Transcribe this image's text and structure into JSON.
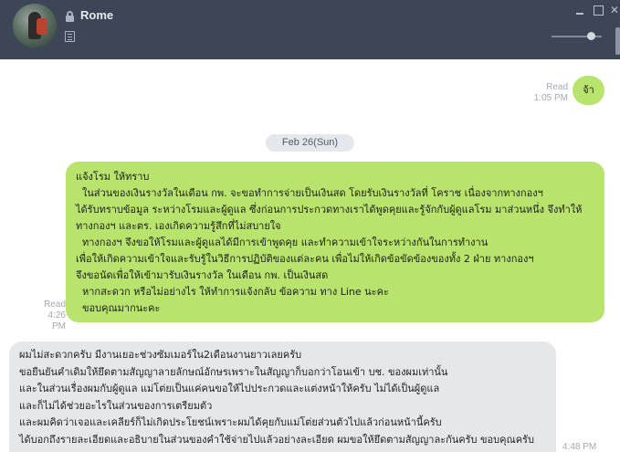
{
  "header": {
    "chat_name": "Rome"
  },
  "messages": {
    "m1": {
      "text": "จ้า",
      "status": "Read",
      "time": "1:05 PM"
    },
    "date_separator": "Feb 26(Sun)",
    "m2": {
      "status": "Read",
      "time": "4:26 PM",
      "lines": [
        "แจ้งโรม ให้ทราบ",
        "  ในส่วนของเงินรางวัลในเดือน กพ. จะขอทำการจ่ายเป็นเงินสด โดยรับเงินรางวัลที่ โคราช เนื่องจากทางกองฯ",
        "ได้รับทราบข้อมูล ระหว่างโรมและผู้ดูแล ซึ่งก่อนการประกวดทางเราได้พูดคุยและรู้จักกับผู้ดูแลโรม มาส่วนหนึ่ง จึงทำให้",
        "ทางกองฯ และตร. เองเกิดความรู้สึกที่ไม่สบายใจ",
        "  ทางกองฯ จึงขอให้โรมและผู้ดูแลได้มีการเข้าพูดคุย และทำความเข้าใจระหว่างกันในการทำงาน",
        "เพื่อให้เกิดความเข้าใจและรับรู้ในวิธีการปฏิบัติของแต่ละคน เพื่อไม่ให้เกิดข้อขัดข้องของทั้ง 2 ฝ่าย ทางกองฯ",
        "จึงขอนัดเพื่อให้เข้ามารับเงินรางวัล ในเดือน กพ. เป็นเงินสด",
        "  หากสะดวก หรือไม่อย่างไร ให้ทำการแจ้งกลับ ข้อความ ทาง Line นะคะ",
        "  ขอบคุณมากนะคะ"
      ]
    },
    "m3": {
      "time": "4:48 PM",
      "lines": [
        "ผมไม่สะดวกครับ มีงานเยอะช่วงซัมเมอร์ใน2เดือนงานยาวเลยครับ",
        "ขอยืนยันคำเดิมให้ยึดตามสัญญาลายลักษณ์อักษรเพราะในสัญญาก็บอกว่าโอนเข้า บช. ของผมเท่านั้น",
        "และในส่วนเรื่องผมกับผู้ดูแล แม่โต่ยเป็นแค่คนขอให้ไปประกวดและแต่งหน้าให้ครับ ไม่ได้เป็นผู้ดูแล",
        "และก็ไม่ได้ช่วยอะไรในส่วนของการเตรียมตัว",
        "และผมคิดว่าเจอและเคลียร์ก็ไม่เกิดประโยชน์เพราะผมได้คุยกับแม่โต่ยส่วนตัวไปแล้วก่อนหน้านี้ครับ",
        "ได้บอกถึงรายละเอียดและอธิบายในส่วนของคำใช้จ่ายไปแล้วอย่างละเอียด ผมขอให้ยึดตามสัญญาละกันครับ ขอบคุณครับ"
      ]
    }
  },
  "colors": {
    "header_bg": "#3c4657",
    "outgoing_bubble": "#b8e36c",
    "incoming_bubble": "#e5e7ea"
  }
}
